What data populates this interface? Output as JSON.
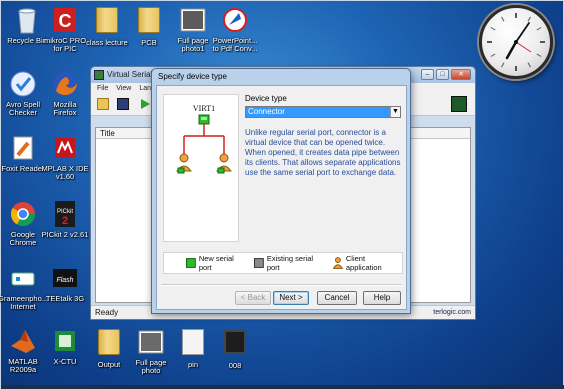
{
  "desktop": {
    "icons": [
      {
        "label": "Recycle Bin",
        "icon": "recycle-bin-icon"
      },
      {
        "label": "mikroC PRO\nfor PIC",
        "icon": "mikroc-icon"
      },
      {
        "label": "class lecture",
        "icon": "folder-icon"
      },
      {
        "label": "PCB",
        "icon": "folder-icon"
      },
      {
        "label": "Full page\nphoto1",
        "icon": "image-file-icon"
      },
      {
        "label": "PowerPoint...\nto Pdf Conv...",
        "icon": "converter-icon"
      },
      {
        "label": "Avro Spell\nChecker",
        "icon": "avro-icon"
      },
      {
        "label": "Mozilla\nFirefox",
        "icon": "firefox-icon"
      },
      {
        "label": "Foxit Reader",
        "icon": "foxit-icon"
      },
      {
        "label": "MPLAB X IDE\nv1.60",
        "icon": "mplab-icon"
      },
      {
        "label": "Google\nChrome",
        "icon": "chrome-icon"
      },
      {
        "label": "PICkit 2 v2.61",
        "icon": "pickit-icon"
      },
      {
        "label": "Grameenpho...\nInternet",
        "icon": "modem-icon"
      },
      {
        "label": "TEEtalk 3G",
        "icon": "flash-icon"
      },
      {
        "label": "MATLAB\nR2009a",
        "icon": "matlab-icon"
      },
      {
        "label": "X-CTU",
        "icon": "xctu-icon"
      },
      {
        "label": "Output",
        "icon": "folder-icon"
      },
      {
        "label": "Full page\nphoto",
        "icon": "image-file-icon"
      },
      {
        "label": "pin",
        "icon": "text-file-icon"
      },
      {
        "label": "008",
        "icon": "chip-file-icon"
      }
    ]
  },
  "background_window": {
    "title": "Virtual Serial Po",
    "menu": [
      "File",
      "View",
      "Lang"
    ],
    "table_header": "Title",
    "status": "Ready",
    "status_link": "terlogic.com"
  },
  "dialog": {
    "title": "Specify device type",
    "device_type_label": "Device type",
    "device_type_value": "Connector",
    "preview_title": "VIRT1",
    "description": "Unlike regular serial port, connector is a virtual device that can be opened twice. When opened, it creates data pipe between its clients. That allows separate applications use the same serial port to exchange data.",
    "legend": {
      "new_port": "New serial port",
      "existing_port": "Existing serial port",
      "client_app": "Client application"
    },
    "buttons": {
      "back": "< Back",
      "next": "Next >",
      "cancel": "Cancel",
      "help": "Help"
    }
  },
  "colors": {
    "desktop_blue": "#1e64b4",
    "selection_blue": "#3399ff",
    "description_text": "#2a4d9c",
    "port_green": "#2db82d",
    "tree_red": "#d42020"
  }
}
